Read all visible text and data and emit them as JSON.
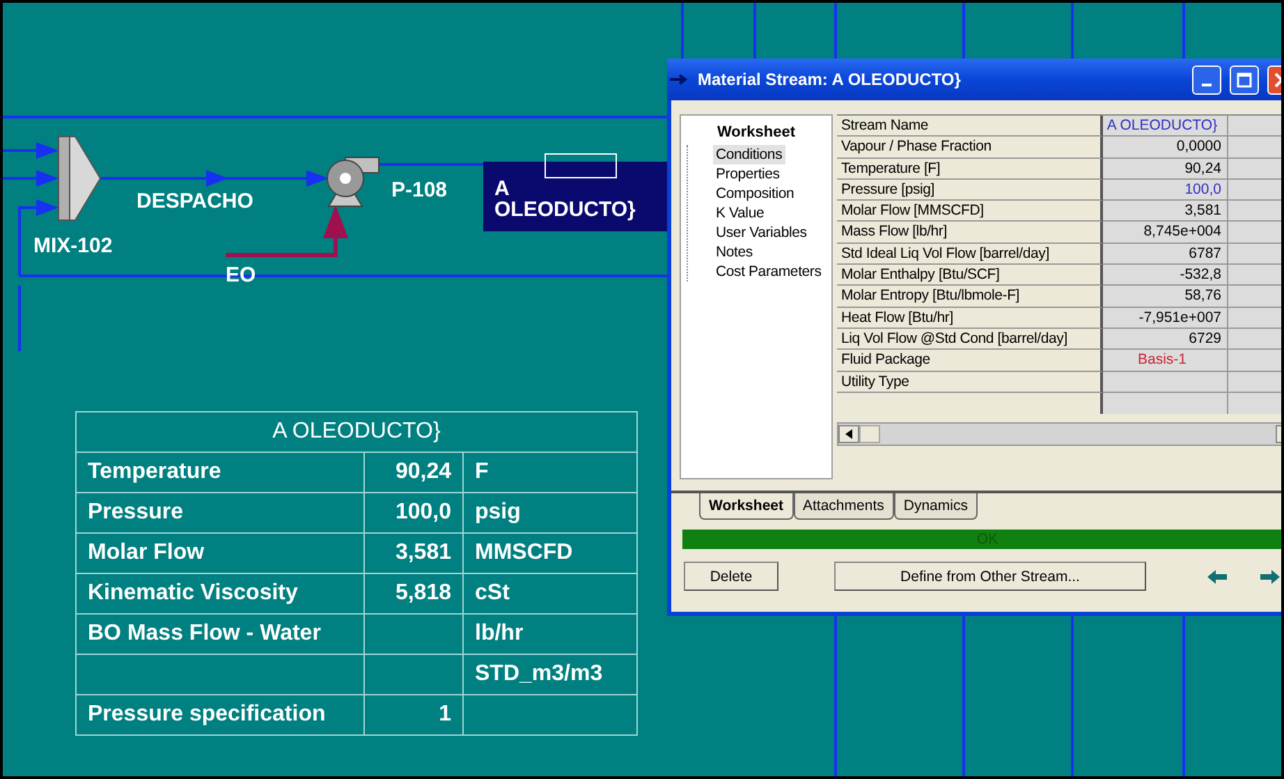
{
  "flowsheet": {
    "units": [
      {
        "kind": "mixer",
        "label": "MIX-102"
      },
      {
        "kind": "pump",
        "label": "P-108"
      }
    ],
    "streams": [
      {
        "kind": "material",
        "label": "DESPACHO"
      },
      {
        "kind": "energy",
        "label": "EO"
      }
    ],
    "selected_stream": {
      "label": "A OLEODUCTO}"
    }
  },
  "stream_table": {
    "title": "A OLEODUCTO}",
    "rows": [
      {
        "name": "Temperature",
        "value": "90,24",
        "unit": "F"
      },
      {
        "name": "Pressure",
        "value": "100,0",
        "unit": "psig"
      },
      {
        "name": "Molar Flow",
        "value": "3,581",
        "unit": "MMSCFD"
      },
      {
        "name": "Kinematic Viscosity",
        "value": "5,818",
        "unit": "cSt"
      },
      {
        "name": "BO Mass Flow - Water",
        "unit": "lb/hr"
      },
      {
        "unit": "STD_m3/m3"
      },
      {
        "name": "Pressure specification",
        "value": "1"
      }
    ]
  },
  "window": {
    "title": "Material Stream: A OLEODUCTO}",
    "nav": {
      "header": "Worksheet",
      "items": [
        {
          "label": "Conditions",
          "selected": true
        },
        {
          "label": "Properties",
          "selected": false
        },
        {
          "label": "Composition",
          "selected": false
        },
        {
          "label": "K Value",
          "selected": false
        },
        {
          "label": "User Variables",
          "selected": false
        },
        {
          "label": "Notes",
          "selected": false
        },
        {
          "label": "Cost Parameters",
          "selected": false
        }
      ]
    },
    "grid": [
      {
        "name": "Stream Name",
        "value": "A OLEODUCTO}",
        "color": "#3030c0"
      },
      {
        "name": "Vapour / Phase Fraction",
        "value": "0,0000",
        "color": "#000000"
      },
      {
        "name": "Temperature [F]",
        "value": "90,24",
        "color": "#000000"
      },
      {
        "name": "Pressure [psig]",
        "value": "100,0",
        "color": "#3030c0"
      },
      {
        "name": "Molar Flow [MMSCFD]",
        "value": "3,581",
        "color": "#000000"
      },
      {
        "name": "Mass Flow [lb/hr]",
        "value": "8,745e+004",
        "color": "#000000"
      },
      {
        "name": "Std Ideal Liq Vol Flow [barrel/day]",
        "value": "6787",
        "color": "#000000"
      },
      {
        "name": "Molar Enthalpy [Btu/SCF]",
        "value": "-532,8",
        "color": "#000000"
      },
      {
        "name": "Molar Entropy [Btu/lbmole-F]",
        "value": "58,76",
        "color": "#000000"
      },
      {
        "name": "Heat Flow [Btu/hr]",
        "value": "-7,951e+007",
        "color": "#000000"
      },
      {
        "name": "Liq Vol Flow @Std Cond [barrel/day]",
        "value": "6729",
        "color": "#000000"
      },
      {
        "name": "Fluid Package",
        "value": "Basis-1",
        "color": "#d02030"
      },
      {
        "name": "Utility Type"
      }
    ],
    "tabs": [
      {
        "label": "Worksheet",
        "selected": true
      },
      {
        "label": "Attachments",
        "selected": false
      },
      {
        "label": "Dynamics",
        "selected": false
      }
    ],
    "status": "OK",
    "buttons": [
      "Delete",
      "Define from Other Stream..."
    ]
  }
}
